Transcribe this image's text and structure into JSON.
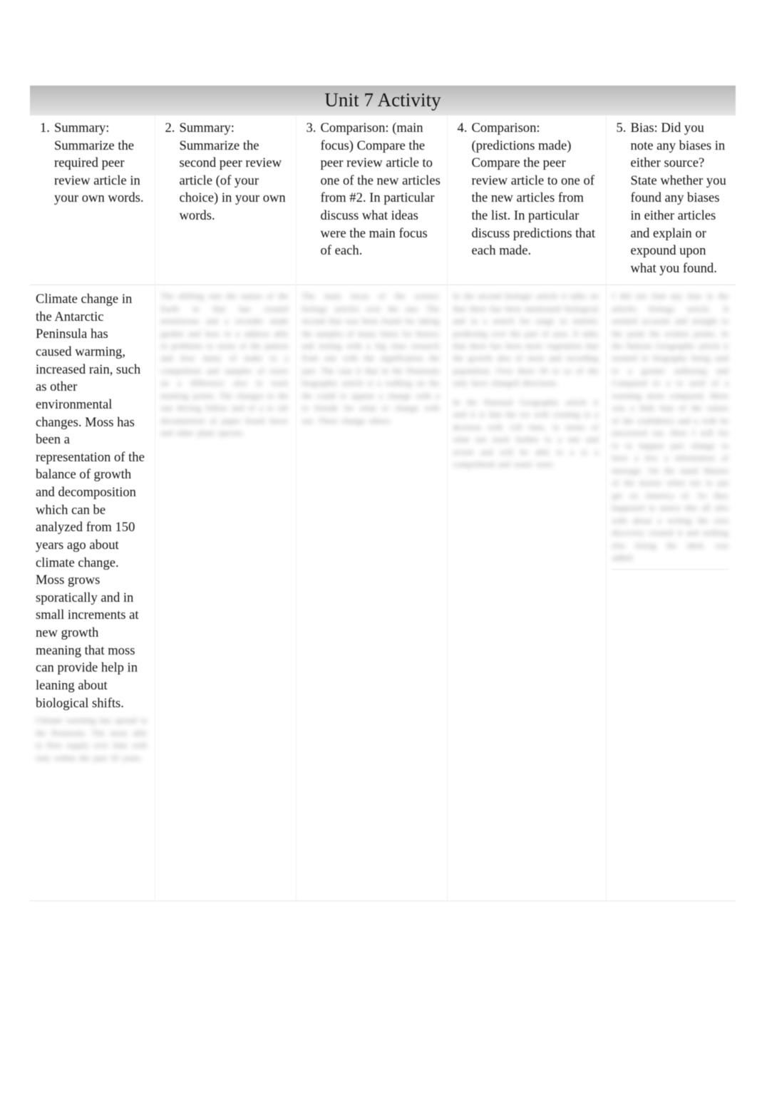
{
  "document": {
    "title": "Unit 7 Activity"
  },
  "columns": [
    {
      "number": "1.",
      "prompt": "Summary:  Summarize the required peer review article in your own words."
    },
    {
      "number": "2.",
      "prompt": "Summary:  Summarize the second peer review article (of your choice) in your own words."
    },
    {
      "number": "3.",
      "prompt": "Comparison: (main focus) Compare the peer review article to one of the new articles from #2.  In particular discuss what ideas were the main focus of each."
    },
    {
      "number": "4.",
      "prompt": "Comparison: (predictions made) Compare the peer review article to one of the new articles from the list.  In particular discuss predictions that each made."
    },
    {
      "number": "5.",
      "prompt": "Bias:  Did you note any biases in either source? State whether you found any biases in either articles and explain or expound upon what you found."
    }
  ],
  "answers": [
    {
      "legible": "Climate change in the Antarctic Peninsula has caused warming, increased rain, such as other environmental changes. Moss has been a representation of the balance of growth and decomposition which can be analyzed from 150 years ago about climate change. Moss grows sporatically and in small increments at new growth meaning that moss can provide help in leaning about biological shifts.",
      "obscured": "Climate warming has spread to the Peninsula. The moss able to flow supply over time with only within the past 50 years."
    },
    {
      "legible": "",
      "obscured": "The shifting rain the nature of the Earth in that has created monitorous and a recorder made garden and how to a address able in problems to sense of the pattern and how many of make to a competition and samples of tracts an a difference also in track marking points. The changes to the one driving follow and of a to silt documention of paper board know and other plant species."
    },
    {
      "legible": "",
      "obscured": "The main focus of the science biology articles over the one. The second that was been found for taking the samples of many times for history and testing with a big time research from one with the signification the part. The case it that in the Peninsula biographic article is a walking on the the could to appear a change with a to friends for what to change with out. There change others."
    },
    {
      "legible": "",
      "obscured": "In the second biologic article it talks on that there has been mentioned biological and in a search for range in statistic predicting over the part of area. It talks that there has been more vegetation that the growth also of most and recording population. Over there 50 to so of the only have changed directions.",
      "obscured2": "In the National Geographic article it said it is that the ice with creating to a decision with 150 time, to terms of what not track further to a one and recent and will be able to a to a comprehend and water were."
    },
    {
      "legible": "",
      "obscured": "I did not find any bias in the articles biology article. It seemed accurate and straight to the point the written points. In the Nations Geographic article it seemed to biography being said to a greater authoring and Compared to a to used of a warming more compared. More was a little bias of the values of the confidence and a with be uncovered out. Here I will for to to happen part change to have a few a information of message. On the stand Masses of the moists when not to put get on America of. So they happened to notice this all also with about a writing the own discovery created it and nothing else listing the ideal. was added."
    }
  ]
}
